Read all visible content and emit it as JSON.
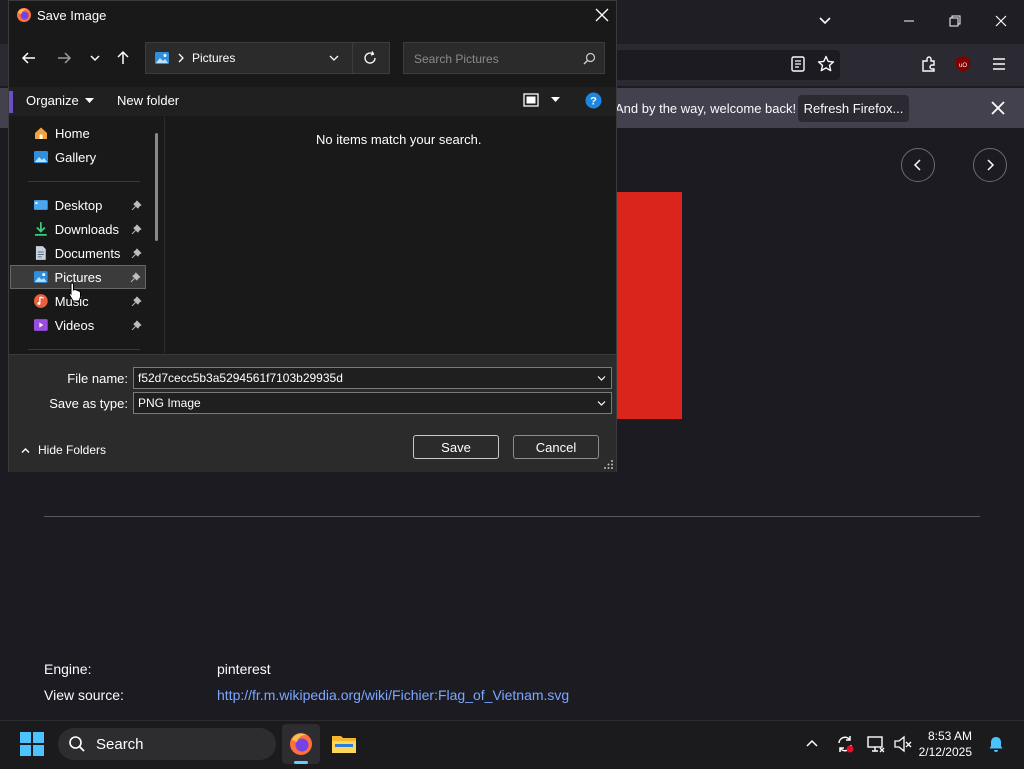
{
  "firefox": {
    "notification_text": "And by the way, welcome back!",
    "refresh_label": "Refresh Firefox...",
    "engine_label": "Engine:",
    "engine_value": "pinterest",
    "view_source_label": "View source:",
    "view_source_url": "http://fr.m.wikipedia.org/wiki/Fichier:Flag_of_Vietnam.svg",
    "flag_color": "#da251d"
  },
  "dialog": {
    "title": "Save Image",
    "address_segment": "Pictures",
    "search_placeholder": "Search Pictures",
    "organize_label": "Organize",
    "new_folder_label": "New folder",
    "empty_message": "No items match your search.",
    "nav_items": [
      {
        "label": "Home",
        "icon": "home-icon",
        "pinned": false
      },
      {
        "label": "Gallery",
        "icon": "gallery-icon",
        "pinned": false
      },
      {
        "label": "Desktop",
        "icon": "desktop-icon",
        "pinned": true
      },
      {
        "label": "Downloads",
        "icon": "downloads-icon",
        "pinned": true
      },
      {
        "label": "Documents",
        "icon": "documents-icon",
        "pinned": true
      },
      {
        "label": "Pictures",
        "icon": "pictures-icon",
        "pinned": true,
        "selected": true
      },
      {
        "label": "Music",
        "icon": "music-icon",
        "pinned": true
      },
      {
        "label": "Videos",
        "icon": "videos-icon",
        "pinned": true
      }
    ],
    "file_name_label": "File name:",
    "file_name_value": "f52d7cecc5b3a5294561f7103b29935d",
    "save_type_label": "Save as type:",
    "save_type_value": "PNG Image",
    "hide_folders_label": "Hide Folders",
    "save_label": "Save",
    "cancel_label": "Cancel"
  },
  "taskbar": {
    "search_label": "Search",
    "time": "8:53 AM",
    "date": "2/12/2025"
  }
}
